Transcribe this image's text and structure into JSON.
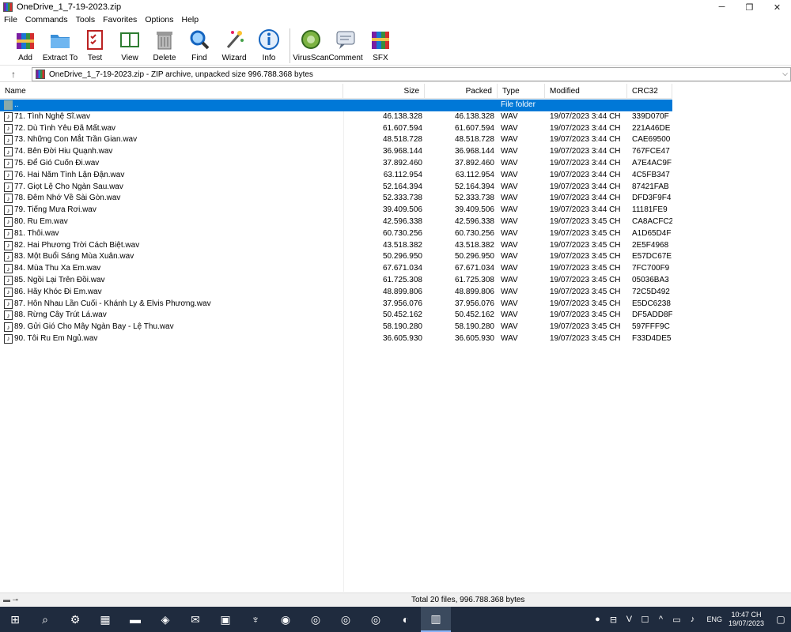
{
  "window": {
    "title": "OneDrive_1_7-19-2023.zip",
    "minimize": "─",
    "maximize": "❐",
    "close": "✕"
  },
  "menu": [
    "File",
    "Commands",
    "Tools",
    "Favorites",
    "Options",
    "Help"
  ],
  "toolbar": [
    {
      "label": "Add",
      "icon": "add-archive-icon"
    },
    {
      "label": "Extract To",
      "icon": "extract-folder-icon"
    },
    {
      "label": "Test",
      "icon": "test-checklist-icon"
    },
    {
      "label": "View",
      "icon": "view-book-icon"
    },
    {
      "label": "Delete",
      "icon": "delete-trash-icon"
    },
    {
      "label": "Find",
      "icon": "find-magnifier-icon"
    },
    {
      "label": "Wizard",
      "icon": "wizard-wand-icon"
    },
    {
      "label": "Info",
      "icon": "info-icon"
    },
    {
      "label": "VirusScan",
      "icon": "virus-scan-icon"
    },
    {
      "label": "Comment",
      "icon": "comment-icon"
    },
    {
      "label": "SFX",
      "icon": "sfx-icon"
    }
  ],
  "address": {
    "up": "↑",
    "path": "OneDrive_1_7-19-2023.zip - ZIP archive, unpacked size 996.788.368 bytes",
    "dropdown": "⌵"
  },
  "columns": {
    "name": "Name",
    "size": "Size",
    "packed": "Packed",
    "type": "Type",
    "modified": "Modified",
    "crc": "CRC32"
  },
  "parent_row": {
    "name": "..",
    "type": "File folder"
  },
  "files": [
    {
      "name": "71. Tình Nghệ Sĩ.wav",
      "size": "46.138.328",
      "packed": "46.138.328",
      "type": "WAV",
      "modified": "19/07/2023 3:44 CH",
      "crc": "339D070F"
    },
    {
      "name": "72. Dù Tình Yêu Đã Mất.wav",
      "size": "61.607.594",
      "packed": "61.607.594",
      "type": "WAV",
      "modified": "19/07/2023 3:44 CH",
      "crc": "221A46DE"
    },
    {
      "name": "73. Những Con Mắt Trần Gian.wav",
      "size": "48.518.728",
      "packed": "48.518.728",
      "type": "WAV",
      "modified": "19/07/2023 3:44 CH",
      "crc": "CAE69500"
    },
    {
      "name": "74. Bên Đời Hiu Quạnh.wav",
      "size": "36.968.144",
      "packed": "36.968.144",
      "type": "WAV",
      "modified": "19/07/2023 3:44 CH",
      "crc": "767FCE47"
    },
    {
      "name": "75. Để Gió Cuốn Đi.wav",
      "size": "37.892.460",
      "packed": "37.892.460",
      "type": "WAV",
      "modified": "19/07/2023 3:44 CH",
      "crc": "A7E4AC9F"
    },
    {
      "name": "76. Hai Năm Tình Lận Đận.wav",
      "size": "63.112.954",
      "packed": "63.112.954",
      "type": "WAV",
      "modified": "19/07/2023 3:44 CH",
      "crc": "4C5FB347"
    },
    {
      "name": "77. Giọt Lệ Cho Ngàn Sau.wav",
      "size": "52.164.394",
      "packed": "52.164.394",
      "type": "WAV",
      "modified": "19/07/2023 3:44 CH",
      "crc": "87421FAB"
    },
    {
      "name": "78. Đêm Nhớ Về Sài Gòn.wav",
      "size": "52.333.738",
      "packed": "52.333.738",
      "type": "WAV",
      "modified": "19/07/2023 3:44 CH",
      "crc": "DFD3F9F4"
    },
    {
      "name": "79. Tiếng Mưa Rơi.wav",
      "size": "39.409.506",
      "packed": "39.409.506",
      "type": "WAV",
      "modified": "19/07/2023 3:44 CH",
      "crc": "11181FE9"
    },
    {
      "name": "80. Ru Em.wav",
      "size": "42.596.338",
      "packed": "42.596.338",
      "type": "WAV",
      "modified": "19/07/2023 3:45 CH",
      "crc": "CA8ACFC2"
    },
    {
      "name": "81. Thôi.wav",
      "size": "60.730.256",
      "packed": "60.730.256",
      "type": "WAV",
      "modified": "19/07/2023 3:45 CH",
      "crc": "A1D65D4F"
    },
    {
      "name": "82. Hai Phương Trời Cách Biệt.wav",
      "size": "43.518.382",
      "packed": "43.518.382",
      "type": "WAV",
      "modified": "19/07/2023 3:45 CH",
      "crc": "2E5F4968"
    },
    {
      "name": "83. Một Buổi Sáng Mùa Xuân.wav",
      "size": "50.296.950",
      "packed": "50.296.950",
      "type": "WAV",
      "modified": "19/07/2023 3:45 CH",
      "crc": "E57DC67E"
    },
    {
      "name": "84. Mùa Thu Xa Em.wav",
      "size": "67.671.034",
      "packed": "67.671.034",
      "type": "WAV",
      "modified": "19/07/2023 3:45 CH",
      "crc": "7FC700F9"
    },
    {
      "name": "85. Ngồi Lại Trên Đồi.wav",
      "size": "61.725.308",
      "packed": "61.725.308",
      "type": "WAV",
      "modified": "19/07/2023 3:45 CH",
      "crc": "05036BA3"
    },
    {
      "name": "86. Hãy Khóc Đi Em.wav",
      "size": "48.899.806",
      "packed": "48.899.806",
      "type": "WAV",
      "modified": "19/07/2023 3:45 CH",
      "crc": "72C5D492"
    },
    {
      "name": "87. Hôn Nhau Lần Cuối - Khánh Ly & Elvis Phương.wav",
      "size": "37.956.076",
      "packed": "37.956.076",
      "type": "WAV",
      "modified": "19/07/2023 3:45 CH",
      "crc": "E5DC6238"
    },
    {
      "name": "88. Rừng Cây Trút Lá.wav",
      "size": "50.452.162",
      "packed": "50.452.162",
      "type": "WAV",
      "modified": "19/07/2023 3:45 CH",
      "crc": "DF5ADD8F"
    },
    {
      "name": "89. Gửi Gió Cho Mây Ngàn Bay - Lệ Thu.wav",
      "size": "58.190.280",
      "packed": "58.190.280",
      "type": "WAV",
      "modified": "19/07/2023 3:45 CH",
      "crc": "597FFF9C"
    },
    {
      "name": "90. Tôi Ru Em Ngủ.wav",
      "size": "36.605.930",
      "packed": "36.605.930",
      "type": "WAV",
      "modified": "19/07/2023 3:45 CH",
      "crc": "F33D4DE5"
    }
  ],
  "status": {
    "text": "Total 20 files, 996.788.368 bytes",
    "icons": "▬ ⊸"
  },
  "taskbar": {
    "apps": [
      "start-icon",
      "search-icon",
      "settings-icon",
      "app-grid-icon",
      "file-explorer-icon",
      "app-icon",
      "mail-icon",
      "app-icon",
      "fox-icon",
      "firefox-icon",
      "chrome-profile-icon",
      "chrome-icon",
      "chrome-icon",
      "app-icon",
      "winrar-icon"
    ],
    "lang": "ENG",
    "time": "10:47 CH",
    "date": "19/07/2023"
  }
}
